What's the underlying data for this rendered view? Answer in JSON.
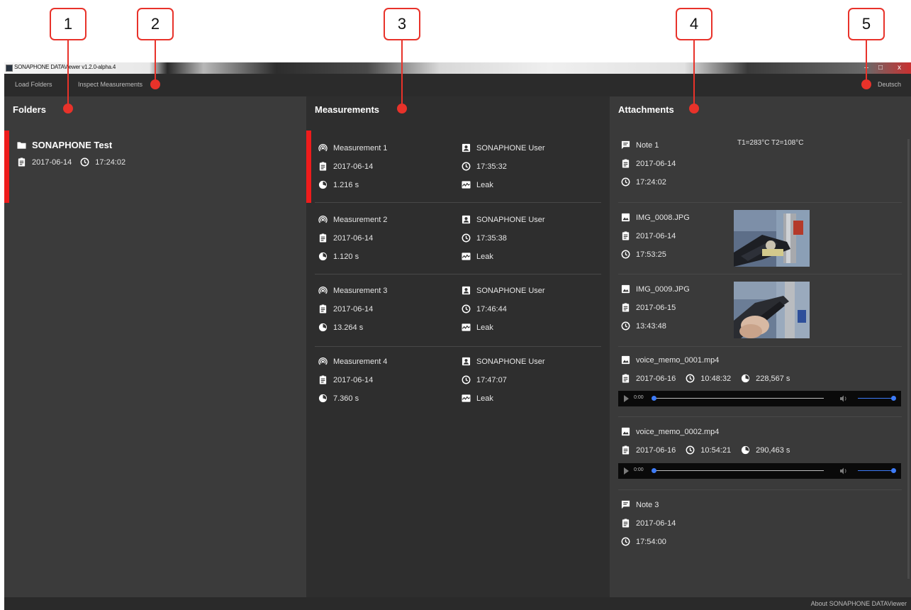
{
  "callouts": [
    "1",
    "2",
    "3",
    "4",
    "5"
  ],
  "window": {
    "title": "SONAPHONE DATAViewer v1.2.0-alpha.4",
    "minimize": "–",
    "maximize": "□",
    "close": "x"
  },
  "menu": {
    "load_folders": "Load Folders",
    "inspect_measurements": "Inspect Measurements",
    "language": "Deutsch"
  },
  "panels": {
    "folders_title": "Folders",
    "measurements_title": "Measurements",
    "attachments_title": "Attachments"
  },
  "folders": [
    {
      "name": "SONAPHONE Test",
      "date": "2017-06-14",
      "time": "17:24:02"
    }
  ],
  "measurements": [
    {
      "name": "Measurement 1",
      "user": "SONAPHONE User",
      "date": "2017-06-14",
      "time": "17:35:32",
      "duration": "1.216 s",
      "type": "Leak"
    },
    {
      "name": "Measurement 2",
      "user": "SONAPHONE User",
      "date": "2017-06-14",
      "time": "17:35:38",
      "duration": "1.120 s",
      "type": "Leak"
    },
    {
      "name": "Measurement 3",
      "user": "SONAPHONE User",
      "date": "2017-06-14",
      "time": "17:46:44",
      "duration": "13.264 s",
      "type": "Leak"
    },
    {
      "name": "Measurement 4",
      "user": "SONAPHONE User",
      "date": "2017-06-14",
      "time": "17:47:07",
      "duration": "7.360 s",
      "type": "Leak"
    }
  ],
  "attachments": {
    "note1": {
      "name": "Note 1",
      "content": "T1=283°C  T2=108°C",
      "date": "2017-06-14",
      "time": "17:24:02"
    },
    "img8": {
      "name": "IMG_0008.JPG",
      "date": "2017-06-14",
      "time": "17:53:25"
    },
    "img9": {
      "name": "IMG_0009.JPG",
      "date": "2017-06-15",
      "time": "13:43:48"
    },
    "voice1": {
      "name": "voice_memo_0001.mp4",
      "date": "2017-06-16",
      "time": "10:48:32",
      "duration": "228,567 s",
      "player_time": "0:00"
    },
    "voice2": {
      "name": "voice_memo_0002.mp4",
      "date": "2017-06-16",
      "time": "10:54:21",
      "duration": "290,463 s",
      "player_time": "0:00"
    },
    "note3": {
      "name": "Note 3",
      "date": "2017-06-14",
      "time": "17:54:00"
    }
  },
  "statusbar": {
    "about": "About SONAPHONE DATAViewer"
  },
  "colors": {
    "accent_red": "#ee1c1c",
    "callout_red": "#e8322a",
    "player_blue": "#3d7bf7"
  }
}
